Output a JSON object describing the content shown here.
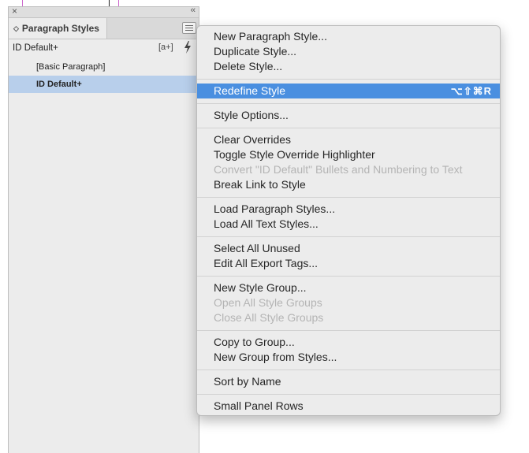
{
  "panel": {
    "close_glyph": "×",
    "collapse_glyph": "‹‹",
    "tab_label": "Paragraph Styles",
    "tab_chevron": "◇",
    "current_style": "ID Default+",
    "new_style_glyph": "[a+]",
    "styles": [
      {
        "label": "[Basic Paragraph]",
        "selected": false
      },
      {
        "label": "ID Default+",
        "selected": true
      }
    ]
  },
  "menu": {
    "groups": [
      [
        "New Paragraph Style...",
        "Duplicate Style...",
        "Delete Style..."
      ],
      [
        "Redefine Style"
      ],
      [
        "Style Options..."
      ],
      [
        "Clear Overrides",
        "Toggle Style Override Highlighter",
        "Convert \"ID Default\" Bullets and Numbering to Text",
        "Break Link to Style"
      ],
      [
        "Load Paragraph Styles...",
        "Load All Text Styles..."
      ],
      [
        "Select All Unused",
        "Edit All Export Tags..."
      ],
      [
        "New Style Group...",
        "Open All Style Groups",
        "Close All Style Groups"
      ],
      [
        "Copy to Group...",
        "New Group from Styles..."
      ],
      [
        "Sort by Name"
      ],
      [
        "Small Panel Rows"
      ]
    ],
    "redefine_shortcut": "⌥⇧⌘R",
    "highlighted_item": "Redefine Style",
    "disabled_items": [
      "Convert \"ID Default\" Bullets and Numbering to Text",
      "Open All Style Groups",
      "Close All Style Groups"
    ]
  },
  "colors": {
    "highlight": "#4a8fe0",
    "selected_row": "#b8cfeb",
    "disabled_text": "#b4b4b4"
  }
}
